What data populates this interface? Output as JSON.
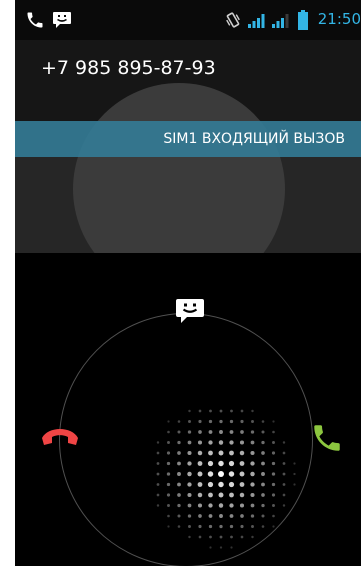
{
  "status_bar": {
    "time": "21:50",
    "icons": [
      "phone-icon",
      "message-icon",
      "vibrate-icon",
      "signal-sim1-icon",
      "signal-sim2-icon",
      "battery-icon"
    ]
  },
  "caller": {
    "number": "+7 985 895-87-93"
  },
  "sim_banner": {
    "label": "SIM1 ВХОДЯЩИЙ ВЫЗОВ"
  },
  "incoming_call_controls": {
    "message_target_icon": "message-icon",
    "decline_target_icon": "decline-call-icon",
    "answer_target_icon": "answer-call-icon"
  },
  "colors": {
    "accent": "#33b5e5",
    "banner": "#337d98",
    "decline": "#f04545",
    "answer": "#8cc63f"
  }
}
